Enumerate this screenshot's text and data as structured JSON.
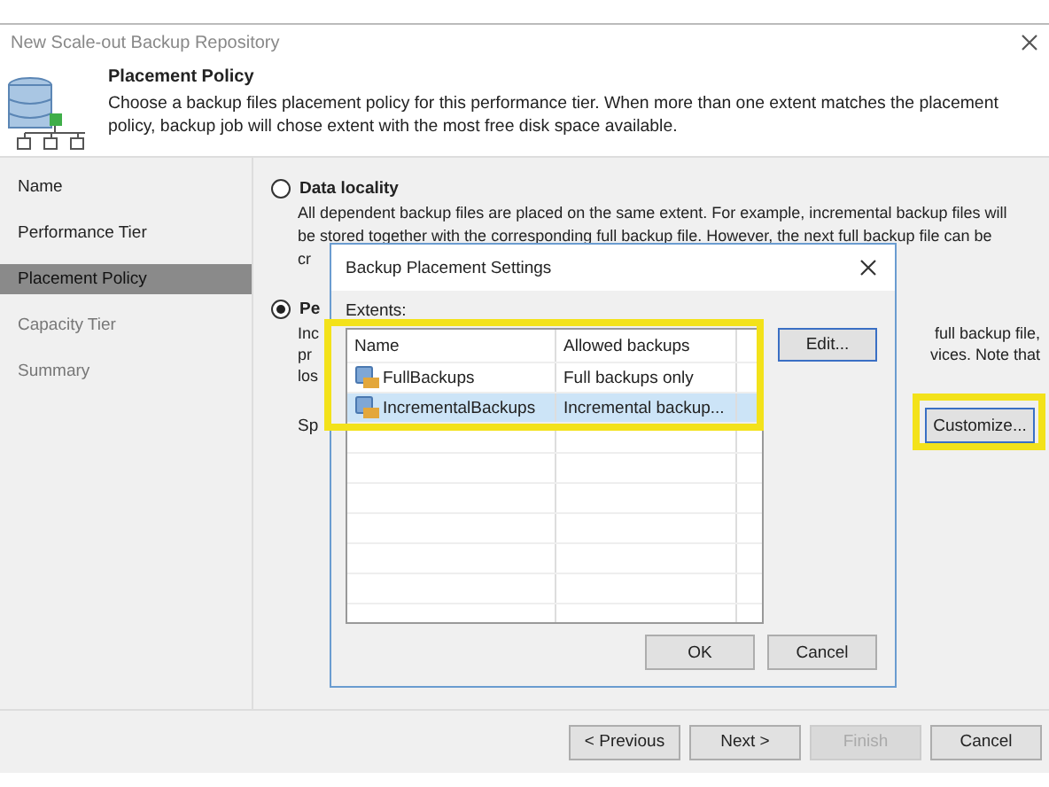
{
  "window": {
    "title": "New Scale-out Backup Repository"
  },
  "header": {
    "title": "Placement Policy",
    "description": "Choose a backup files placement policy for this performance tier. When more than one extent matches the placement policy, backup job will chose extent with the most free disk space available."
  },
  "steps": [
    {
      "label": "Name",
      "selected": false,
      "disabled": false
    },
    {
      "label": "Performance Tier",
      "selected": false,
      "disabled": false
    },
    {
      "label": "Placement Policy",
      "selected": true,
      "disabled": false
    },
    {
      "label": "Capacity Tier",
      "selected": false,
      "disabled": true
    },
    {
      "label": "Summary",
      "selected": false,
      "disabled": true
    }
  ],
  "options": [
    {
      "label": "Data locality",
      "selected": false,
      "description_lines": [
        "All dependent backup files are placed on the same extent. For example, incremental backup files will",
        "be stored together with the corresponding full backup file. However, the next full backup file can be",
        "cr"
      ]
    },
    {
      "label": "Pe",
      "selected": true
    }
  ],
  "covered_lines": [
    {
      "left": "Inc",
      "right": "full backup file,"
    },
    {
      "left": "pr",
      "right": "vices. Note that"
    },
    {
      "left": "los"
    }
  ],
  "setting_label": "Sp",
  "customize_button": "Customize...",
  "dialog": {
    "title": "Backup Placement Settings",
    "extents_label": "Extents:",
    "columns": [
      "Name",
      "Allowed backups"
    ],
    "rows": [
      {
        "name": "FullBackups",
        "allowed": "Full backups only",
        "selected": false
      },
      {
        "name": "IncrementalBackups",
        "allowed": "Incremental backup...",
        "selected": true
      }
    ],
    "edit_button": "Edit...",
    "ok_button": "OK",
    "cancel_button": "Cancel"
  },
  "buttons": [
    {
      "label": "< Previous",
      "disabled": false
    },
    {
      "label": "Next >",
      "disabled": false
    },
    {
      "label": "Finish",
      "disabled": true
    },
    {
      "label": "Cancel",
      "disabled": false
    }
  ]
}
